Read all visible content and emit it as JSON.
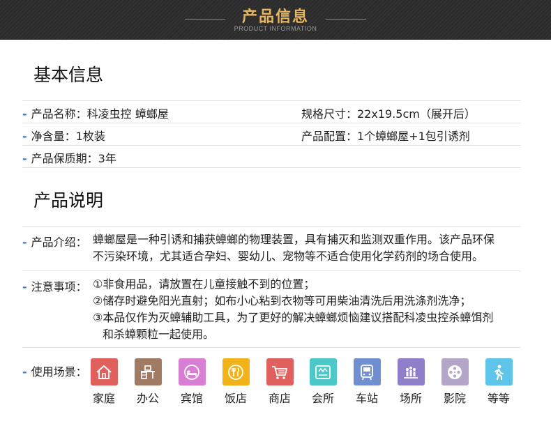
{
  "banner": {
    "title": "产品信息",
    "subtitle": "PRODUCT INFORMATION"
  },
  "basic": {
    "title": "基本信息",
    "rows": [
      {
        "left": "产品名称：科凌虫控 蟑螂屋",
        "right": "规格尺寸：22x19.5cm（展开后）"
      },
      {
        "left": "净含量：1枚装",
        "right": "产品配置：1个蟑螂屋+1包引诱剂"
      },
      {
        "left": "产品保质期：3年",
        "right": ""
      }
    ]
  },
  "description": {
    "title": "产品说明",
    "intro_label": "产品介绍：",
    "intro_lines": [
      "蟑螂屋是一种引诱和捕获蟑螂的物理装置，具有捕灭和监测双重作用。该产品环保",
      "不污染环境，尤其适合孕妇、婴幼儿、宠物等不适合使用化学药剂的场合使用。"
    ],
    "notes_label": "注意事项：",
    "notes_lines": [
      "①非食用品，请放置在儿童接触不到的位置；",
      "②储存时避免阳光直射；如布小心粘到衣物等可用柴油清洗后用洗涤剂洗净；",
      "③本品仅作为灭蟑辅助工具，为了更好的解决蟑螂烦恼建议搭配科凌虫控杀蟑饵剂",
      "和杀蟑颗粒一起使用。"
    ],
    "scenes_label": "使用场景：",
    "scenes": [
      {
        "label": "家庭",
        "icon": "house-icon",
        "color": "#e0605e"
      },
      {
        "label": "办公",
        "icon": "office-desk-icon",
        "color": "#a07a63"
      },
      {
        "label": "宾馆",
        "icon": "hotel-bed-icon",
        "color": "#d97fd3"
      },
      {
        "label": "饭店",
        "icon": "restaurant-icon",
        "color": "#f2b318"
      },
      {
        "label": "商店",
        "icon": "shopping-cart-icon",
        "color": "#e0605e"
      },
      {
        "label": "会所",
        "icon": "club-icon",
        "color": "#4cc8c9"
      },
      {
        "label": "车站",
        "icon": "bus-icon",
        "color": "#6f8fd0"
      },
      {
        "label": "场所",
        "icon": "venue-icon",
        "color": "#8f7ec9"
      },
      {
        "label": "影院",
        "icon": "film-reel-icon",
        "color": "#b3a6c9"
      },
      {
        "label": "等等",
        "icon": "walking-person-icon",
        "color": "#5ec4ea"
      }
    ]
  }
}
